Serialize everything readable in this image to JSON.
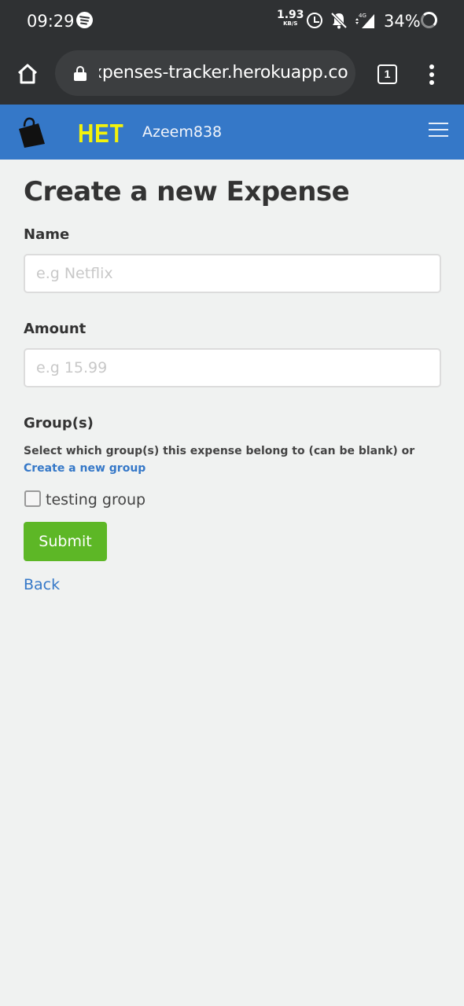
{
  "status_bar": {
    "time": "09:29",
    "app_icon": "spotify-icon",
    "net_speed_value": "1.93",
    "net_speed_unit": "KB/S",
    "network_type": "4G",
    "battery": "34%"
  },
  "browser": {
    "url": "xpenses-tracker.herokuapp.com",
    "tab_count": "1"
  },
  "navbar": {
    "brand": "HET",
    "username": "Azeem838",
    "color": "#3578c8",
    "brand_color": "#f2f20c"
  },
  "form": {
    "title": "Create a new Expense",
    "name_label": "Name",
    "name_placeholder": "e.g Netflix",
    "amount_label": "Amount",
    "amount_placeholder": "e.g 15.99",
    "groups_label": "Group(s)",
    "groups_help": "Select which group(s) this expense belong to (can be blank) or ",
    "create_group_link": "Create a new group",
    "groups": [
      {
        "label": "testing group",
        "checked": false
      }
    ],
    "submit_label": "Submit",
    "submit_color": "#5db726",
    "back_label": "Back"
  }
}
